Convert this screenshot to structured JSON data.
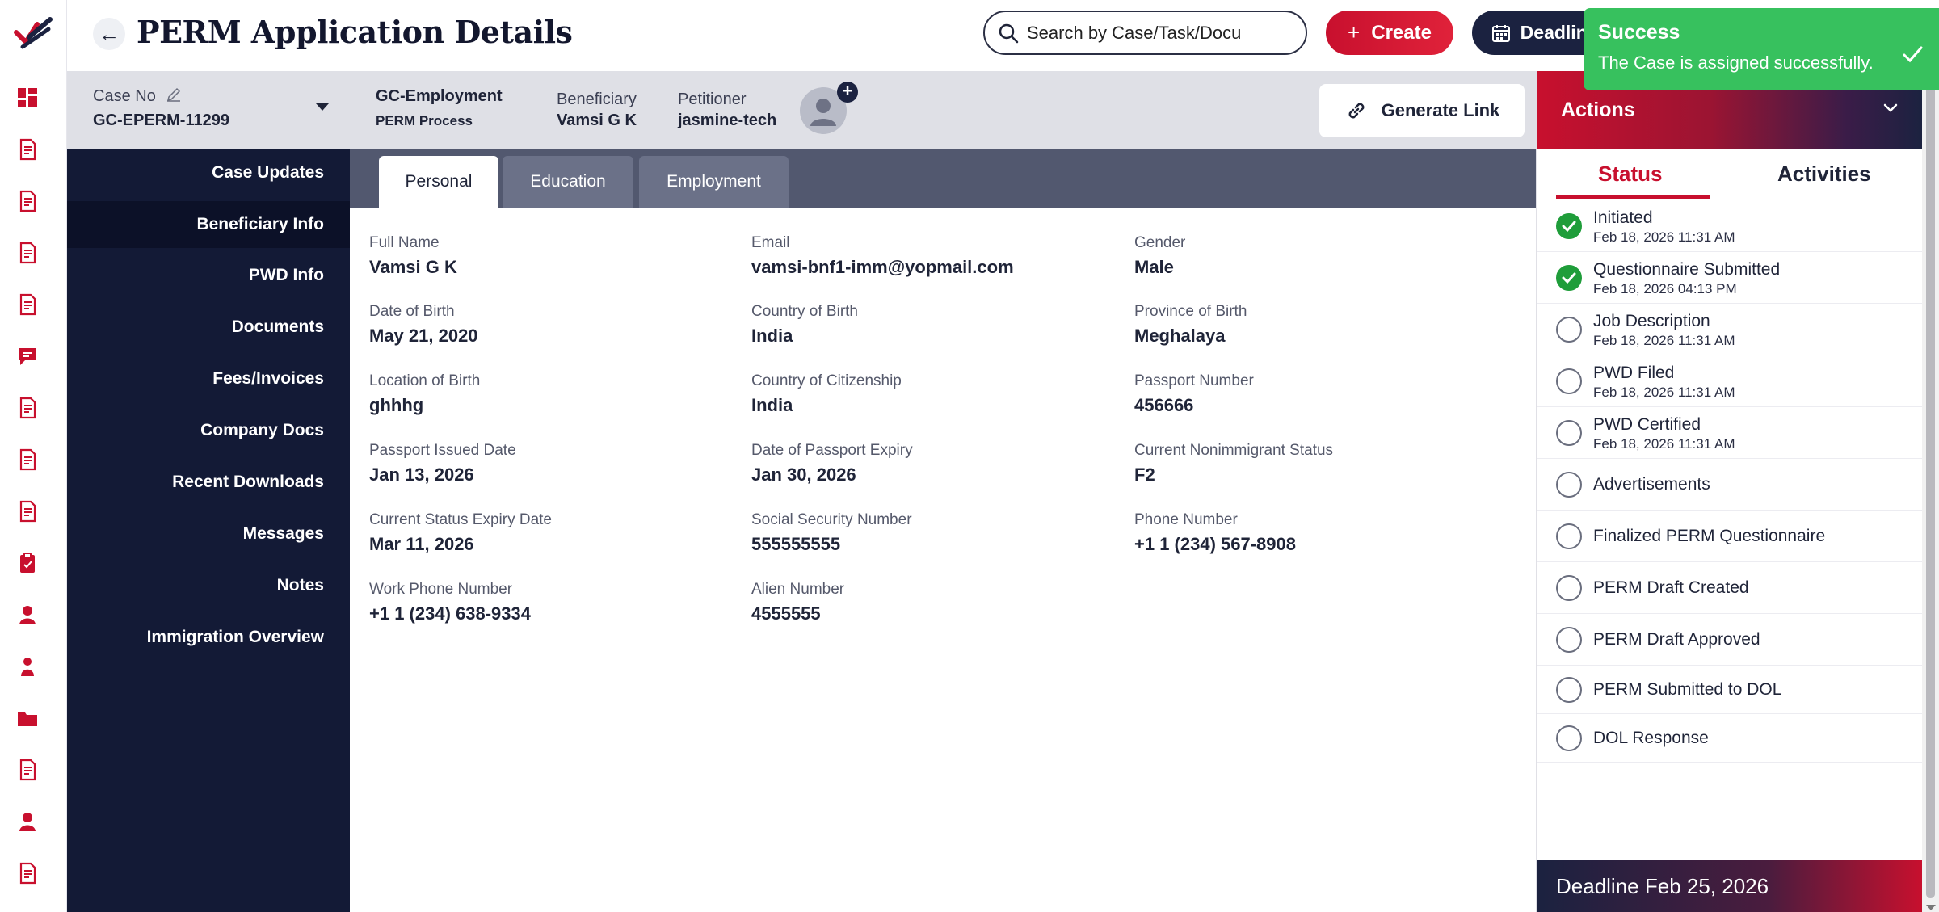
{
  "header": {
    "title": "PERM Application Details",
    "search_placeholder": "Search by Case/Task/Docu",
    "create_label": "Create",
    "create_symbol": "+",
    "deadlines_label": "Deadlines"
  },
  "toast": {
    "title": "Success",
    "message": "The Case is assigned successfully."
  },
  "case_bar": {
    "case_no_label": "Case No",
    "case_no": "GC-EPERM-11299",
    "case_type": "GC-Employment",
    "process": "PERM Process",
    "beneficiary_label": "Beneficiary",
    "beneficiary": "Vamsi G K",
    "petitioner_label": "Petitioner",
    "petitioner": "jasmine-tech",
    "avatar_add_symbol": "+",
    "generate_link_label": "Generate Link"
  },
  "left_nav": [
    "Case Updates",
    "Beneficiary Info",
    "PWD Info",
    "Documents",
    "Fees/Invoices",
    "Company Docs",
    "Recent Downloads",
    "Messages",
    "Notes",
    "Immigration Overview"
  ],
  "tabs": [
    "Personal",
    "Education",
    "Employment"
  ],
  "fields": [
    {
      "label": "Full Name",
      "value": "Vamsi G K"
    },
    {
      "label": "Email",
      "value": "vamsi-bnf1-imm@yopmail.com"
    },
    {
      "label": "Gender",
      "value": "Male"
    },
    {
      "label": "Date of Birth",
      "value": "May 21, 2020"
    },
    {
      "label": "Country of Birth",
      "value": "India"
    },
    {
      "label": "Province of Birth",
      "value": "Meghalaya"
    },
    {
      "label": "Location of Birth",
      "value": "ghhhg"
    },
    {
      "label": "Country of Citizenship",
      "value": "India"
    },
    {
      "label": "Passport Number",
      "value": "456666"
    },
    {
      "label": "Passport Issued Date",
      "value": "Jan 13, 2026"
    },
    {
      "label": "Date of Passport Expiry",
      "value": "Jan 30, 2026"
    },
    {
      "label": "Current Nonimmigrant Status",
      "value": "F2"
    },
    {
      "label": "Current Status Expiry Date",
      "value": "Mar 11, 2026"
    },
    {
      "label": "Social Security Number",
      "value": "555555555"
    },
    {
      "label": "Phone Number",
      "value": "+1 1 (234) 567-8908"
    },
    {
      "label": "Work Phone Number",
      "value": "+1 1 (234) 638-9334"
    },
    {
      "label": "Alien Number",
      "value": "4555555"
    }
  ],
  "actions": {
    "title": "Actions",
    "tab_status": "Status",
    "tab_activities": "Activities",
    "statuses": [
      {
        "name": "Initiated",
        "date": "Feb 18, 2026 11:31 AM",
        "done": true
      },
      {
        "name": "Questionnaire Submitted",
        "date": "Feb 18, 2026 04:13 PM",
        "done": true
      },
      {
        "name": "Job Description",
        "date": "Feb 18, 2026 11:31 AM",
        "done": false
      },
      {
        "name": "PWD Filed",
        "date": "Feb 18, 2026 11:31 AM",
        "done": false
      },
      {
        "name": "PWD Certified",
        "date": "Feb 18, 2026 11:31 AM",
        "done": false
      },
      {
        "name": "Advertisements",
        "date": "",
        "done": false
      },
      {
        "name": "Finalized PERM Questionnaire",
        "date": "",
        "done": false
      },
      {
        "name": "PERM Draft Created",
        "date": "",
        "done": false
      },
      {
        "name": "PERM Draft Approved",
        "date": "",
        "done": false
      },
      {
        "name": "PERM Submitted to DOL",
        "date": "",
        "done": false
      },
      {
        "name": "DOL Response",
        "date": "",
        "done": false
      }
    ],
    "deadline": "Deadline Feb 25, 2026"
  },
  "colors": {
    "brand_red": "#c8102e",
    "navy": "#131a36",
    "success_green": "#37c15e",
    "done_green": "#1f9d3a"
  },
  "rail_icons": [
    "dashboard-icon",
    "document-icon",
    "document-check-icon",
    "calendar-document-icon",
    "document-settings-icon",
    "chat-icon",
    "ledger-icon",
    "edit-document-icon",
    "building-settings-icon",
    "clipboard-icon",
    "user-icon",
    "users-icon",
    "folder-icon",
    "notes-icon",
    "support-agent-icon",
    "receipt-icon"
  ]
}
